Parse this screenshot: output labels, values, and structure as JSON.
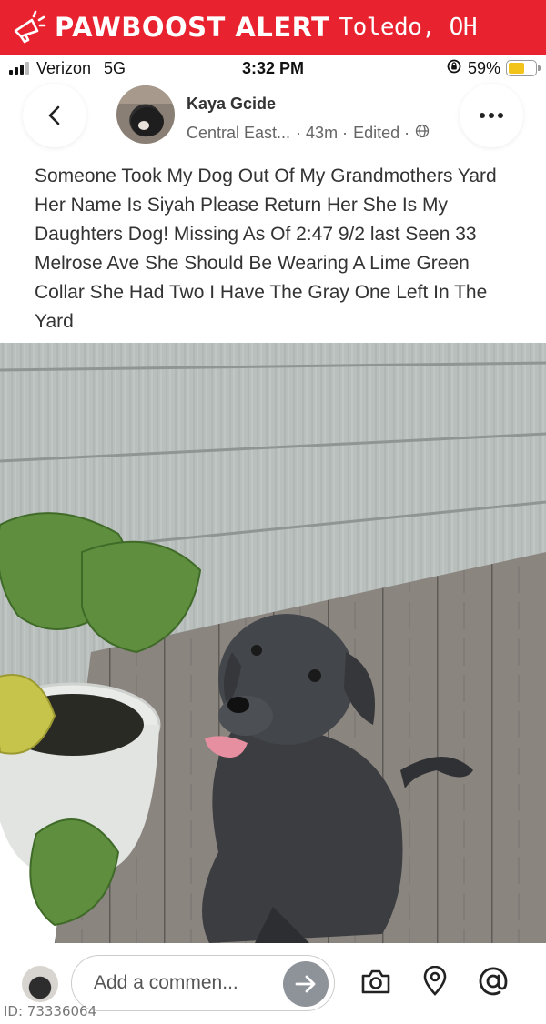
{
  "alert": {
    "brand": "PAWBOOST ALERT",
    "location": "Toledo, OH",
    "color": "#e8232f",
    "icon": "megaphone-icon"
  },
  "status_bar": {
    "carrier": "Verizon",
    "network": "5G",
    "time": "3:32 PM",
    "battery": "59%",
    "battery_level": 0.59
  },
  "post": {
    "author": "Kaya Gcide",
    "group": "Central East...",
    "age": "· 43m ·",
    "edited": "Edited ·",
    "text": "Someone Took My Dog Out Of My Grandmothers Yard Her Name Is Siyah Please Return Her She Is My Daughters Dog! Missing As Of 2:47 9/2 last Seen 33 Melrose Ave She Should Be Wearing A Lime Green Collar She Had Two I Have The Gray One Left In The Yard"
  },
  "comment_bar": {
    "placeholder": "Add a commen...",
    "icons": [
      "camera-icon",
      "location-pin-icon",
      "at-sign-icon"
    ]
  },
  "footer": {
    "id_label": "ID: 73336064"
  }
}
